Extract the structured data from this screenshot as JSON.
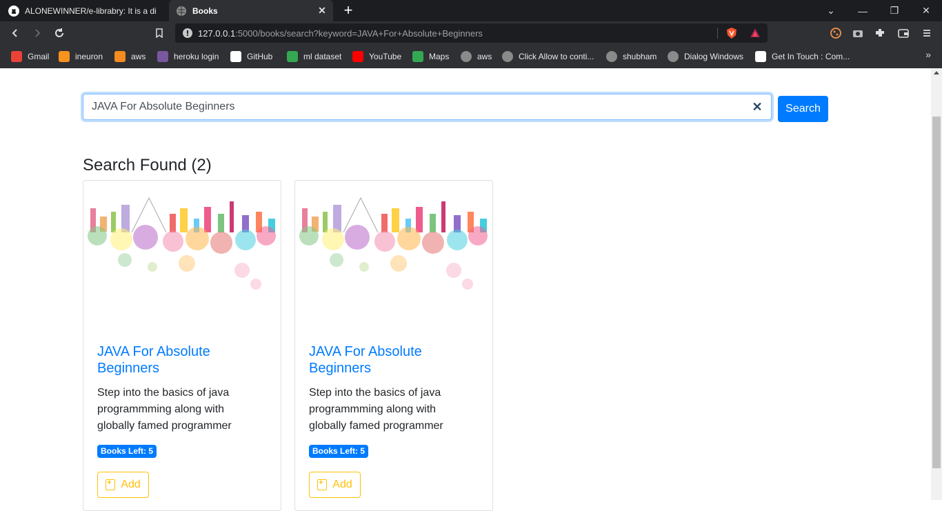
{
  "browser": {
    "tabs": [
      {
        "title": "ALONEWINNER/e-librabry: It is a digit",
        "active": false
      },
      {
        "title": "Books",
        "active": true
      }
    ],
    "new_tab_label": "+",
    "url": {
      "host": "127.0.0.1",
      "rest": ":5000/books/search?keyword=JAVA+For+Absolute+Beginners"
    },
    "bookmarks": [
      {
        "label": "Gmail",
        "icon": "gmail-icon",
        "color": "#ea4335"
      },
      {
        "label": "ineuron",
        "icon": "ineuron-icon",
        "color": "#f7931e"
      },
      {
        "label": "aws",
        "icon": "aws-icon",
        "color": "#f68b1f"
      },
      {
        "label": "heroku login",
        "icon": "heroku-icon",
        "color": "#79589f"
      },
      {
        "label": "GitHub",
        "icon": "github-icon",
        "color": "#ffffff"
      },
      {
        "label": "ml dataset",
        "icon": "drive-icon",
        "color": "#34a853"
      },
      {
        "label": "YouTube",
        "icon": "youtube-icon",
        "color": "#ff0000"
      },
      {
        "label": "Maps",
        "icon": "maps-icon",
        "color": "#34a853"
      },
      {
        "label": "aws",
        "icon": "globe-icon",
        "color": "#8a8a8a"
      },
      {
        "label": "Click Allow to conti...",
        "icon": "globe-icon",
        "color": "#8a8a8a"
      },
      {
        "label": "shubham",
        "icon": "globe-icon",
        "color": "#8a8a8a"
      },
      {
        "label": "Dialog Windows",
        "icon": "globe-icon",
        "color": "#8a8a8a"
      },
      {
        "label": "Get In Touch : Com...",
        "icon": "contact-icon",
        "color": "#ffffff"
      }
    ]
  },
  "search": {
    "value": "JAVA For Absolute Beginners",
    "button_label": "Search",
    "clear_label": "✕"
  },
  "results": {
    "heading": "Search Found (2)",
    "cards": [
      {
        "title": "JAVA For Absolute Beginners",
        "description": "Step into the basics of java programmming along with globally famed programmer",
        "badge": "Books Left: 5",
        "add_label": "Add"
      },
      {
        "title": "JAVA For Absolute Beginners",
        "description": "Step into the basics of java programmming along with globally famed programmer",
        "badge": "Books Left: 5",
        "add_label": "Add"
      }
    ]
  },
  "colors": {
    "primary": "#007bff",
    "warning": "#ffc107",
    "chrome_dark": "#1c1d20",
    "chrome": "#2f3034"
  }
}
